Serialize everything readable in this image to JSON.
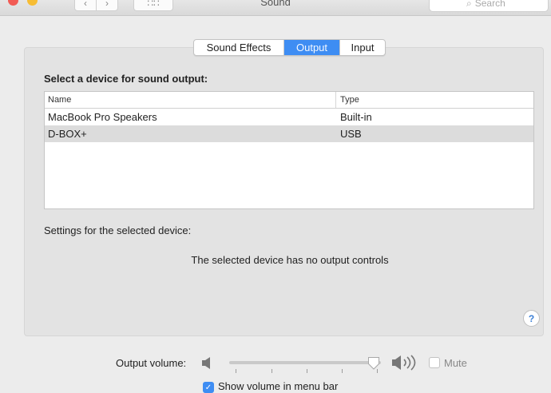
{
  "window": {
    "title": "Sound",
    "search_placeholder": "Search",
    "grid_glyph": "∷∷"
  },
  "tabs": [
    {
      "label": "Sound Effects",
      "selected": false
    },
    {
      "label": "Output",
      "selected": true
    },
    {
      "label": "Input",
      "selected": false
    }
  ],
  "output": {
    "heading": "Select a device for sound output:",
    "columns": {
      "name": "Name",
      "type": "Type"
    },
    "devices": [
      {
        "name": "MacBook Pro Speakers",
        "type": "Built-in",
        "selected": false
      },
      {
        "name": "D-BOX+",
        "type": "USB",
        "selected": true
      }
    ],
    "settings_label": "Settings for the selected device:",
    "no_controls_message": "The selected device has no output controls"
  },
  "volume": {
    "label": "Output volume:",
    "level": 0.95,
    "mute_label": "Mute",
    "muted": false
  },
  "menu_bar": {
    "label": "Show volume in menu bar",
    "checked": true
  },
  "colors": {
    "accent": "#3e8df3",
    "selected_row": "#dcdcdc"
  },
  "icons": {
    "help": "?"
  }
}
